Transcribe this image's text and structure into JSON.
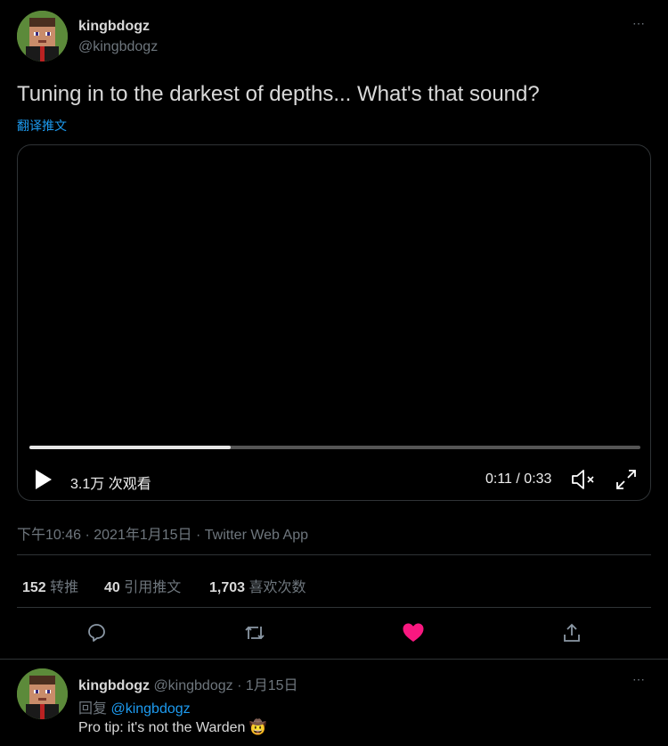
{
  "tweet": {
    "author_name": "kingbdogz",
    "author_handle": "@kingbdogz",
    "more": "⋯",
    "text": "Tuning in to the darkest of depths... What's that sound?",
    "translate": "翻译推文"
  },
  "video": {
    "views": "3.1万 次观看",
    "time": "0:11 / 0:33",
    "progress": 0.33
  },
  "meta": {
    "timestamp": "下午10:46 · 2021年1月15日",
    "separator": " · ",
    "source": "Twitter Web App"
  },
  "stats": {
    "retweets_count": "152",
    "retweets_label": "转推",
    "quotes_count": "40",
    "quotes_label": "引用推文",
    "likes_count": "1,703",
    "likes_label": "喜欢次数"
  },
  "colors": {
    "like": "#f91880",
    "link": "#1d9bf0"
  },
  "reply": {
    "author_name": "kingbdogz",
    "author_handle": "@kingbdogz",
    "date": " · 1月15日",
    "replying_prefix": "回复 ",
    "replying_to": "@kingbdogz",
    "text": "Pro tip: it's not the Warden 🤠",
    "more": "⋯"
  }
}
